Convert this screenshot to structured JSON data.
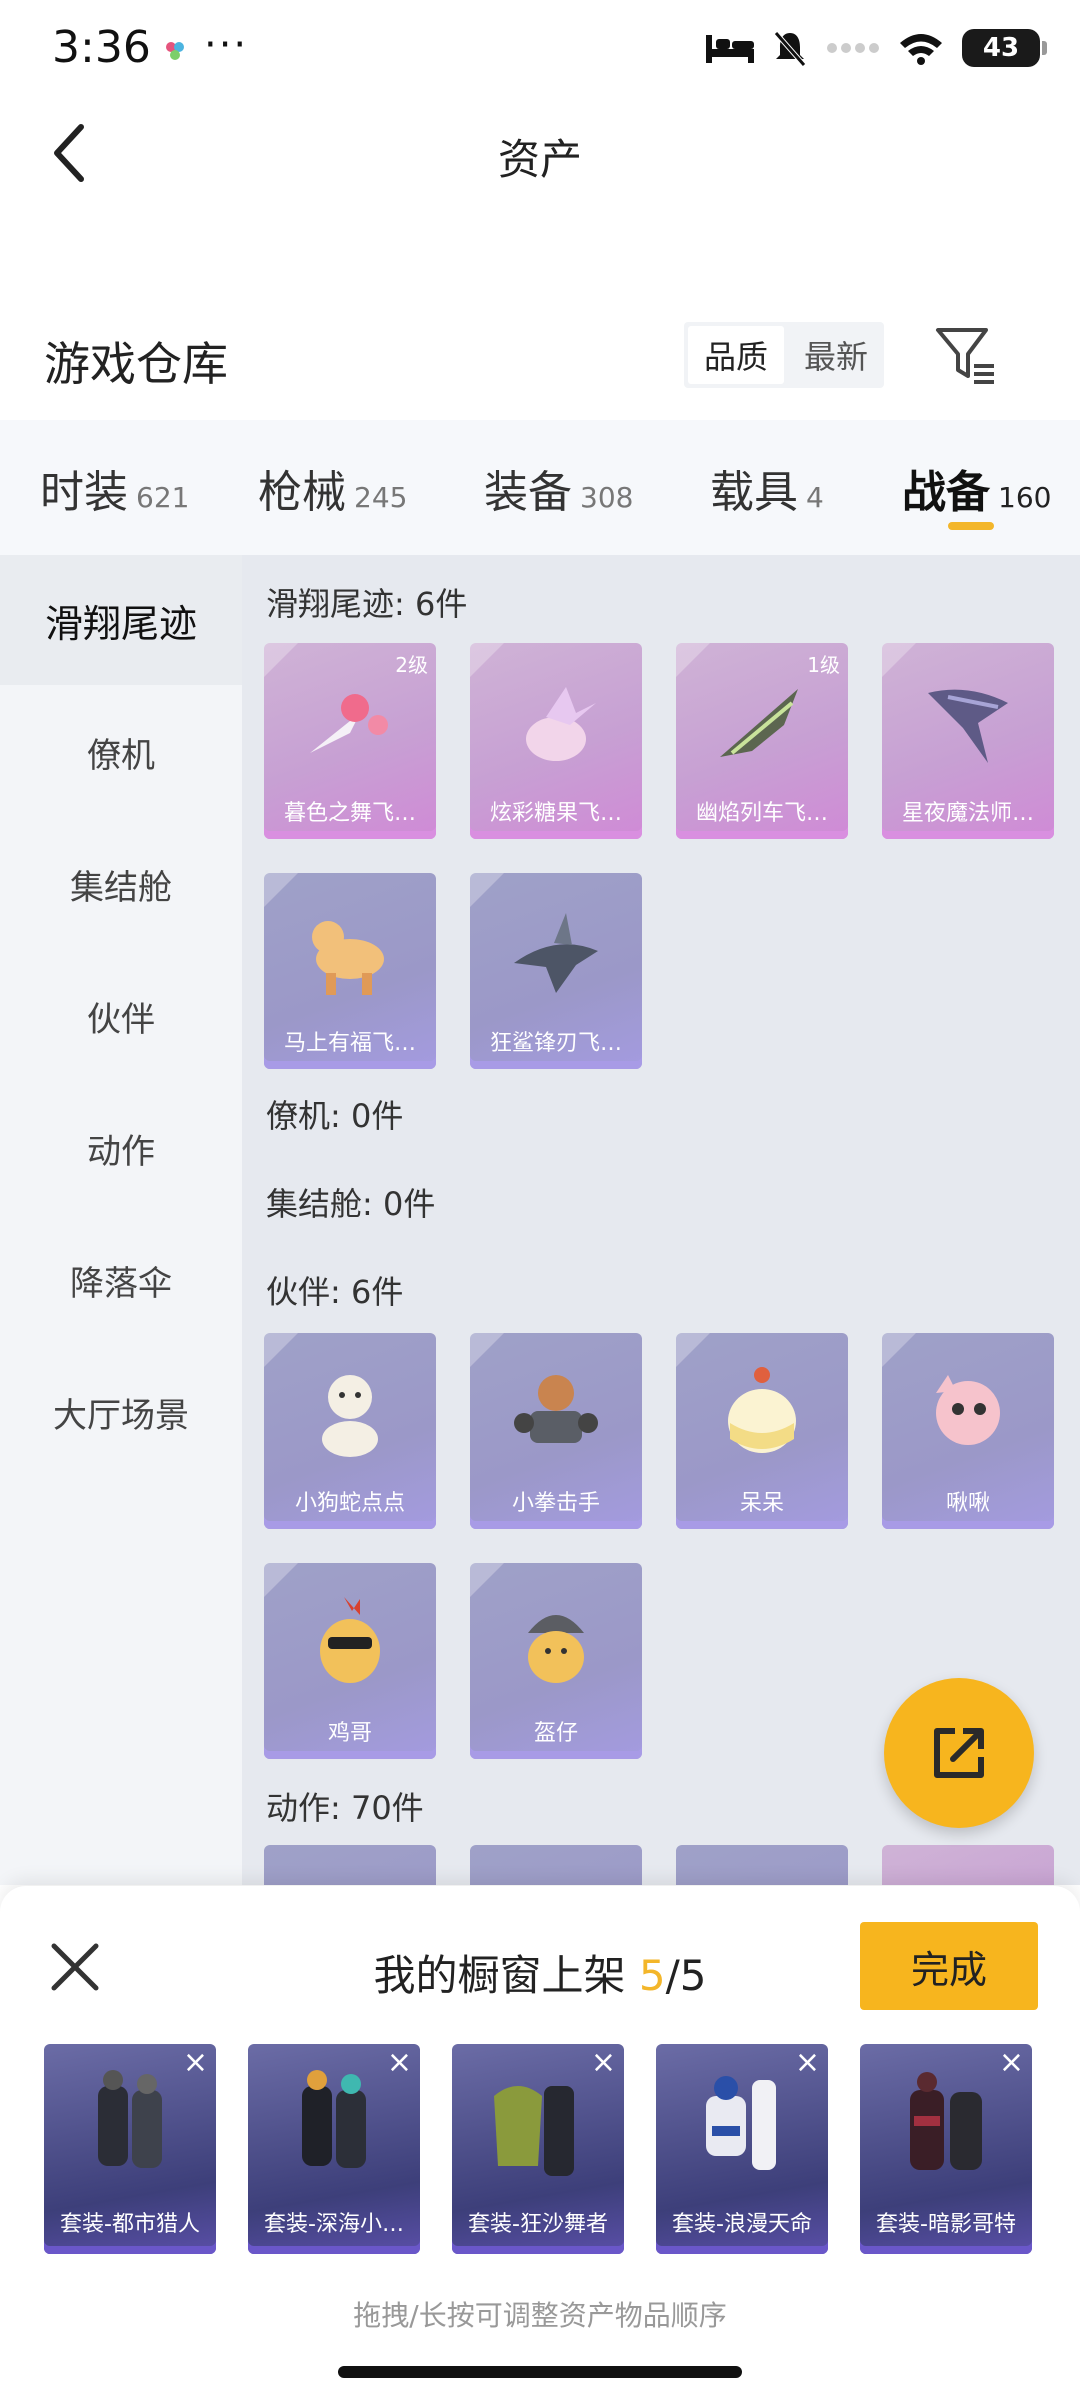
{
  "status": {
    "time": "3:36",
    "more": "···",
    "battery": "43"
  },
  "header": {
    "title": "资产"
  },
  "warehouse": {
    "title": "游戏仓库",
    "sort_options": [
      "品质",
      "最新"
    ]
  },
  "categories": [
    {
      "label": "时装",
      "count": "621"
    },
    {
      "label": "枪械",
      "count": "245"
    },
    {
      "label": "装备",
      "count": "308"
    },
    {
      "label": "载具",
      "count": "4"
    },
    {
      "label": "战备",
      "count": "160"
    }
  ],
  "sidebar": {
    "items": [
      "滑翔尾迹",
      "僚机",
      "集结舱",
      "伙伴",
      "动作",
      "降落伞",
      "大厅场景"
    ]
  },
  "sections": {
    "glide": {
      "title": "滑翔尾迹: 6件",
      "items": [
        {
          "name": "暮色之舞飞…",
          "level": "2级"
        },
        {
          "name": "炫彩糖果飞…",
          "level": ""
        },
        {
          "name": "幽焰列车飞…",
          "level": "1级"
        },
        {
          "name": "星夜魔法师…",
          "level": ""
        },
        {
          "name": "马上有福飞…",
          "level": ""
        },
        {
          "name": "狂鲨锋刃飞…",
          "level": ""
        }
      ]
    },
    "wingman": {
      "title": "僚机: 0件"
    },
    "pod": {
      "title": "集结舱: 0件"
    },
    "partner": {
      "title": "伙伴: 6件",
      "items": [
        {
          "name": "小狗蛇点点"
        },
        {
          "name": "小拳击手"
        },
        {
          "name": "呆呆"
        },
        {
          "name": "啾啾"
        },
        {
          "name": "鸡哥"
        },
        {
          "name": "盔仔"
        }
      ]
    },
    "action": {
      "title": "动作: 70件"
    }
  },
  "sheet": {
    "title_prefix": "我的橱窗上架 ",
    "current": "5",
    "total": "/5",
    "done_label": "完成",
    "hint": "拖拽/长按可调整资产物品顺序",
    "items": [
      "套装-都市猎人",
      "套装-深海小…",
      "套装-狂沙舞者",
      "套装-浪漫天命",
      "套装-暗影哥特"
    ]
  },
  "colors": {
    "accent": "#f7b51e",
    "pink_card": "#d08ad6",
    "purple_card": "#a49be0"
  }
}
